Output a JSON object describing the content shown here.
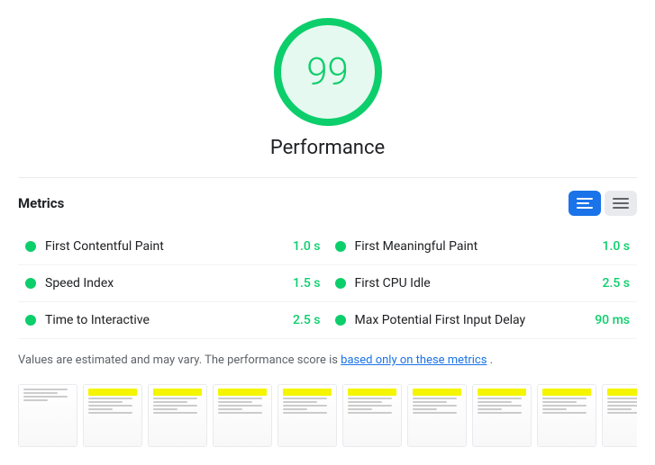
{
  "score": {
    "value": "99",
    "label": "Performance",
    "color": "#0cce6b"
  },
  "metrics": {
    "title": "Metrics",
    "toggle": {
      "list_label": "List view",
      "grid_label": "Grid view"
    },
    "items": [
      {
        "name": "First Contentful Paint",
        "value": "1.0 s",
        "status": "pass"
      },
      {
        "name": "First Meaningful Paint",
        "value": "1.0 s",
        "status": "pass"
      },
      {
        "name": "Speed Index",
        "value": "1.5 s",
        "status": "pass"
      },
      {
        "name": "First CPU Idle",
        "value": "2.5 s",
        "status": "pass"
      },
      {
        "name": "Time to Interactive",
        "value": "2.5 s",
        "status": "pass"
      },
      {
        "name": "Max Potential First Input Delay",
        "value": "90 ms",
        "status": "pass"
      }
    ]
  },
  "disclaimer": {
    "text_before": "Values are estimated and may vary. The performance score is ",
    "link": "based only on these metrics",
    "text_after": "."
  },
  "filmstrip": {
    "count": 10
  }
}
